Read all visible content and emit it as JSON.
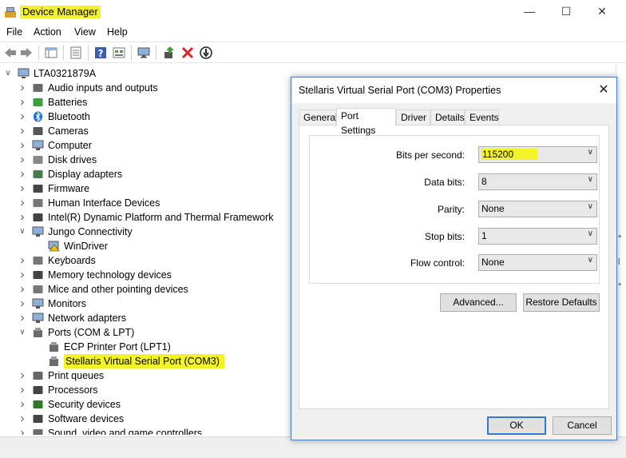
{
  "window": {
    "title": "Device Manager"
  },
  "menu": [
    "File",
    "Action",
    "View",
    "Help"
  ],
  "toolbar": {
    "icons": [
      "back-icon",
      "forward-icon",
      "show-hide-tree-icon",
      "properties-icon",
      "help-icon",
      "view-icon",
      "scan-hardware-icon",
      "update-driver-icon",
      "uninstall-icon",
      "disable-icon"
    ]
  },
  "tree": {
    "root": "LTA0321879A",
    "items": [
      {
        "label": "Audio inputs and outputs",
        "icon": "speaker-icon",
        "expanded": false
      },
      {
        "label": "Batteries",
        "icon": "battery-icon",
        "expanded": false
      },
      {
        "label": "Bluetooth",
        "icon": "bluetooth-icon",
        "expanded": false
      },
      {
        "label": "Cameras",
        "icon": "camera-icon",
        "expanded": false
      },
      {
        "label": "Computer",
        "icon": "computer-icon",
        "expanded": false
      },
      {
        "label": "Disk drives",
        "icon": "disk-icon",
        "expanded": false
      },
      {
        "label": "Display adapters",
        "icon": "display-adapter-icon",
        "expanded": false
      },
      {
        "label": "Firmware",
        "icon": "chip-icon",
        "expanded": false
      },
      {
        "label": "Human Interface Devices",
        "icon": "hid-icon",
        "expanded": false
      },
      {
        "label": "Intel(R) Dynamic Platform and Thermal Framework",
        "icon": "chip-icon",
        "expanded": false
      },
      {
        "label": "Jungo Connectivity",
        "icon": "network-icon",
        "expanded": true
      },
      {
        "label": "WinDriver",
        "icon": "warning-icon",
        "child": true
      },
      {
        "label": "Keyboards",
        "icon": "keyboard-icon",
        "expanded": false
      },
      {
        "label": "Memory technology devices",
        "icon": "chip-icon",
        "expanded": false
      },
      {
        "label": "Mice and other pointing devices",
        "icon": "mouse-icon",
        "expanded": false
      },
      {
        "label": "Monitors",
        "icon": "monitor-icon",
        "expanded": false
      },
      {
        "label": "Network adapters",
        "icon": "network-icon",
        "expanded": false
      },
      {
        "label": "Ports (COM & LPT)",
        "icon": "port-icon",
        "expanded": true
      },
      {
        "label": "ECP Printer Port (LPT1)",
        "icon": "port-icon",
        "child": true
      },
      {
        "label": "Stellaris Virtual Serial Port (COM3)",
        "icon": "port-icon",
        "child": true,
        "highlight": true
      },
      {
        "label": "Print queues",
        "icon": "printer-icon",
        "expanded": false
      },
      {
        "label": "Processors",
        "icon": "chip-icon",
        "expanded": false
      },
      {
        "label": "Security devices",
        "icon": "security-icon",
        "expanded": false
      },
      {
        "label": "Software devices",
        "icon": "chip-icon",
        "expanded": false
      },
      {
        "label": "Sound, video and game controllers",
        "icon": "speaker-icon",
        "expanded": false
      }
    ]
  },
  "dialog": {
    "title": "Stellaris Virtual Serial Port (COM3) Properties",
    "tabs": [
      "General",
      "Port Settings",
      "Driver",
      "Details",
      "Events"
    ],
    "active_tab": "Port Settings",
    "fields": [
      {
        "label": "Bits per second:",
        "value": "115200"
      },
      {
        "label": "Data bits:",
        "value": "8"
      },
      {
        "label": "Parity:",
        "value": "None"
      },
      {
        "label": "Stop bits:",
        "value": "1"
      },
      {
        "label": "Flow control:",
        "value": "None"
      }
    ],
    "advanced_label": "Advanced...",
    "restore_label": "Restore Defaults",
    "ok_label": "OK",
    "cancel_label": "Cancel"
  },
  "colors": {
    "highlight": "#f4f22a",
    "accent": "#2d7bd6",
    "dialog_border": "#4a7dc0"
  }
}
